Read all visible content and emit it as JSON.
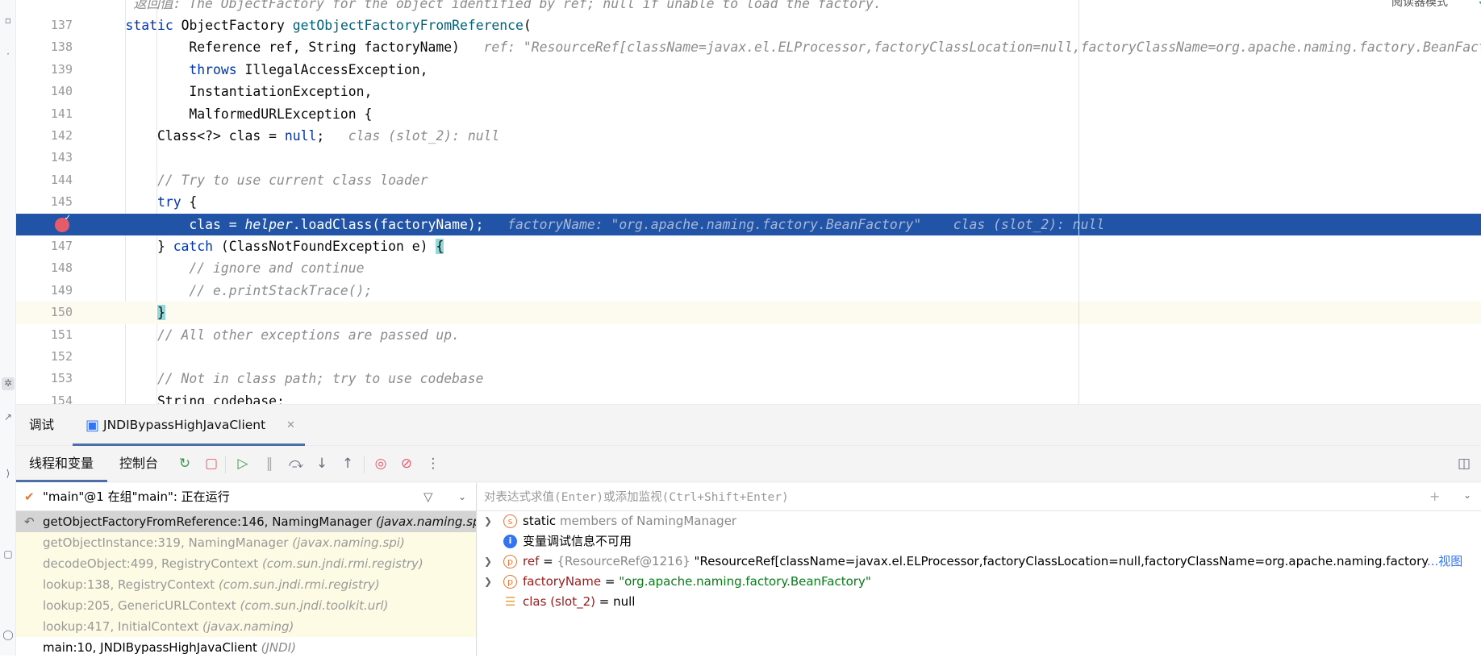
{
  "editor": {
    "reader_mode": "阅读器模式",
    "lines": [
      {
        "n": "",
        "tokens": [
          {
            "t": "     返回值: The ObjectFactory for the object identified by ref; null if unable to load the factory.",
            "k": "cm"
          }
        ]
      },
      {
        "n": "137",
        "tokens": [
          {
            "t": "    "
          },
          {
            "t": "static",
            "k": "kw"
          },
          {
            "t": " ObjectFactory "
          },
          {
            "t": "getObjectFactoryFromReference",
            "k": "fn"
          },
          {
            "t": "("
          }
        ]
      },
      {
        "n": "138",
        "tokens": [
          {
            "t": "            Reference ref, String factoryName)  "
          },
          {
            "t": " ref: \"ResourceRef[className=javax.el.ELProcessor,factoryClassLocation=null,factoryClassName=org.apache.naming.factory.BeanFactory,{type: scope,content: }]\"",
            "k": "hint"
          }
        ]
      },
      {
        "n": "139",
        "tokens": [
          {
            "t": "            "
          },
          {
            "t": "throws",
            "k": "kw"
          },
          {
            "t": " IllegalAccessException,"
          }
        ]
      },
      {
        "n": "140",
        "tokens": [
          {
            "t": "            InstantiationException,"
          }
        ]
      },
      {
        "n": "141",
        "tokens": [
          {
            "t": "            MalformedURLException {"
          }
        ]
      },
      {
        "n": "142",
        "tokens": [
          {
            "t": "        Class<?> clas = "
          },
          {
            "t": "null",
            "k": "kw"
          },
          {
            "t": ";  "
          },
          {
            "t": " clas (slot_2): null",
            "k": "hint"
          }
        ]
      },
      {
        "n": "143",
        "tokens": []
      },
      {
        "n": "144",
        "tokens": [
          {
            "t": "        // Try to use current class loader",
            "k": "cm"
          }
        ]
      },
      {
        "n": "145",
        "tokens": [
          {
            "t": "        "
          },
          {
            "t": "try",
            "k": "kw"
          },
          {
            "t": " {"
          }
        ]
      },
      {
        "n": "",
        "exec": true,
        "tokens": [
          {
            "t": "            clas = "
          },
          {
            "t": "helper",
            "k": "it"
          },
          {
            "t": ".loadClass(factoryName);  "
          },
          {
            "t": " factoryName: \"org.apache.naming.factory.BeanFactory\"    clas (slot_2): null",
            "k": "hint"
          }
        ]
      },
      {
        "n": "147",
        "tokens": [
          {
            "t": "        } "
          },
          {
            "t": "catch",
            "k": "kw"
          },
          {
            "t": " (ClassNotFoundException e) "
          },
          {
            "t": "{",
            "k": "br"
          }
        ]
      },
      {
        "n": "148",
        "tokens": [
          {
            "t": "            // ignore and continue",
            "k": "cm"
          }
        ]
      },
      {
        "n": "149",
        "tokens": [
          {
            "t": "            // e.printStackTrace();",
            "k": "cm"
          }
        ]
      },
      {
        "n": "150",
        "caret": true,
        "tokens": [
          {
            "t": "        "
          },
          {
            "t": "}",
            "k": "br"
          }
        ]
      },
      {
        "n": "151",
        "tokens": [
          {
            "t": "        // All other exceptions are passed up.",
            "k": "cm"
          }
        ]
      },
      {
        "n": "152",
        "tokens": []
      },
      {
        "n": "153",
        "tokens": [
          {
            "t": "        // Not in class path; try to use codebase",
            "k": "cm"
          }
        ]
      },
      {
        "n": "154",
        "tokens": [
          {
            "t": "        String codebase;"
          }
        ]
      }
    ]
  },
  "debug_panel": {
    "title": "调试",
    "session_tab": "JNDIBypassHighJavaClient",
    "subtabs": [
      "线程和变量",
      "控制台"
    ],
    "toolbar_icons": [
      "rerun-icon",
      "stop-icon",
      "resume-icon",
      "pause-icon",
      "step-over-icon",
      "step-into-icon",
      "step-out-icon",
      "view-breakpoints-icon",
      "mute-breakpoints-icon",
      "more-icon"
    ],
    "thread": "\"main\"@1 在组\"main\": 正在运行",
    "frames": [
      {
        "method": "getObjectFactoryFromReference:146, NamingManager",
        "pkg": "(javax.naming.spi)",
        "state": "sel"
      },
      {
        "method": "getObjectInstance:319, NamingManager",
        "pkg": "(javax.naming.spi)",
        "state": "lib"
      },
      {
        "method": "decodeObject:499, RegistryContext",
        "pkg": "(com.sun.jndi.rmi.registry)",
        "state": "lib"
      },
      {
        "method": "lookup:138, RegistryContext",
        "pkg": "(com.sun.jndi.rmi.registry)",
        "state": "lib"
      },
      {
        "method": "lookup:205, GenericURLContext",
        "pkg": "(com.sun.jndi.toolkit.url)",
        "state": "lib"
      },
      {
        "method": "lookup:417, InitialContext",
        "pkg": "(javax.naming)",
        "state": "lib"
      },
      {
        "method": "main:10, JNDIBypassHighJavaClient",
        "pkg": "(JNDI)",
        "state": "app"
      }
    ],
    "watch_placeholder": "对表达式求值(Enter)或添加监视(Ctrl+Shift+Enter)",
    "variables": {
      "static": {
        "kw": "static",
        "rest": " members of NamingManager"
      },
      "info": "变量调试信息不可用",
      "ref": {
        "name": "ref",
        "eq": " = ",
        "type": "{ResourceRef@1216}",
        "value": " \"ResourceRef[className=javax.el.ELProcessor,factoryClassLocation=null,factoryClassName=org.apache.naming.factory",
        "more": "...视图"
      },
      "factoryName": {
        "name": "factoryName",
        "eq": " = ",
        "value": "\"org.apache.naming.factory.BeanFactory\""
      },
      "clas": {
        "name": "clas",
        "slot": " (slot_2)",
        "eq": " = ",
        "value": "null"
      }
    }
  },
  "colors": {
    "execution_line": "#2154a6",
    "keyword": "#0033b3",
    "method": "#00627a",
    "string": "#067d17",
    "breakpoint": "#e55b6a"
  }
}
